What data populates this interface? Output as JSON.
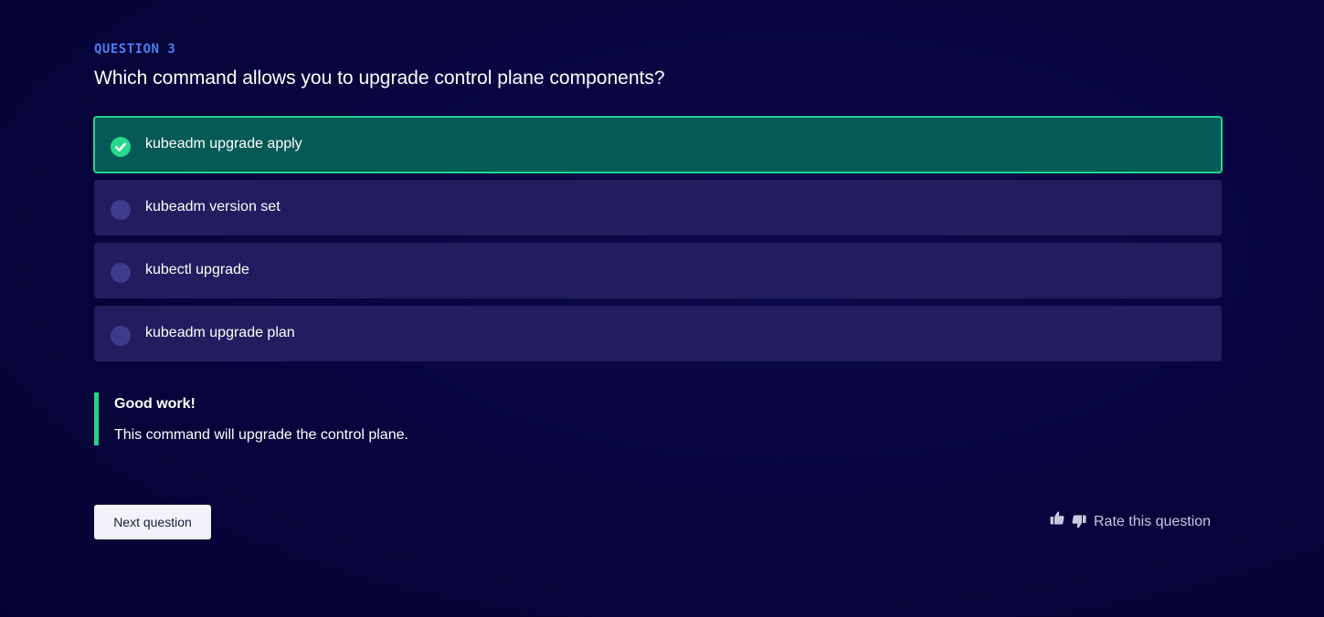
{
  "question": {
    "eyebrow": "QUESTION 3",
    "text": "Which command allows you to upgrade control plane components?"
  },
  "options": [
    {
      "label": "kubeadm upgrade apply",
      "state": "selected-correct"
    },
    {
      "label": "kubeadm version set",
      "state": "unselected"
    },
    {
      "label": "kubectl upgrade",
      "state": "unselected"
    },
    {
      "label": "kubeadm upgrade plan",
      "state": "unselected"
    }
  ],
  "feedback": {
    "title": "Good work!",
    "body": "This command will upgrade the control plane."
  },
  "actions": {
    "next_label": "Next question",
    "rate_label": "Rate this question",
    "thumbs_up_icon": "thumbs-up-icon",
    "thumbs_down_icon": "thumbs-down-icon"
  },
  "colors": {
    "background": "#07043a",
    "accent_blue": "#4d7ef0",
    "correct_green": "#22d38a",
    "selected_bg": "#055957",
    "option_bg": "#211d5e",
    "radio_idle": "#3f3a8e"
  }
}
